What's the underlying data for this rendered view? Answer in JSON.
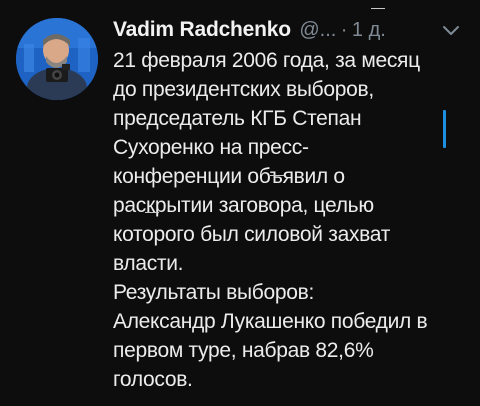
{
  "tweet": {
    "author_name": "Vadim Radchenko",
    "handle": "@...",
    "separator": "·",
    "time": "1 д.",
    "lines": [
      "21 февраля 2006 года, за месяц",
      "до президентских выборов,",
      "председатель КГБ Степан",
      "Сухоренко на пресс-",
      "конференции объявил о",
      "раскрытии заговора, целью",
      "которого был силовой захват",
      "власти.",
      "Результаты выборов:",
      "Александр Лукашенко победил в",
      "первом туре, набрав 82,6%",
      "голосов."
    ]
  },
  "icons": {
    "avatar": "avatar-photo",
    "menu": "chevron-down-icon"
  },
  "colors": {
    "background": "#0d0d0d",
    "text": "#ececec",
    "muted": "#7f8a94",
    "accent": "#1d8fe0",
    "avatar_bg": "#1e63c4"
  }
}
